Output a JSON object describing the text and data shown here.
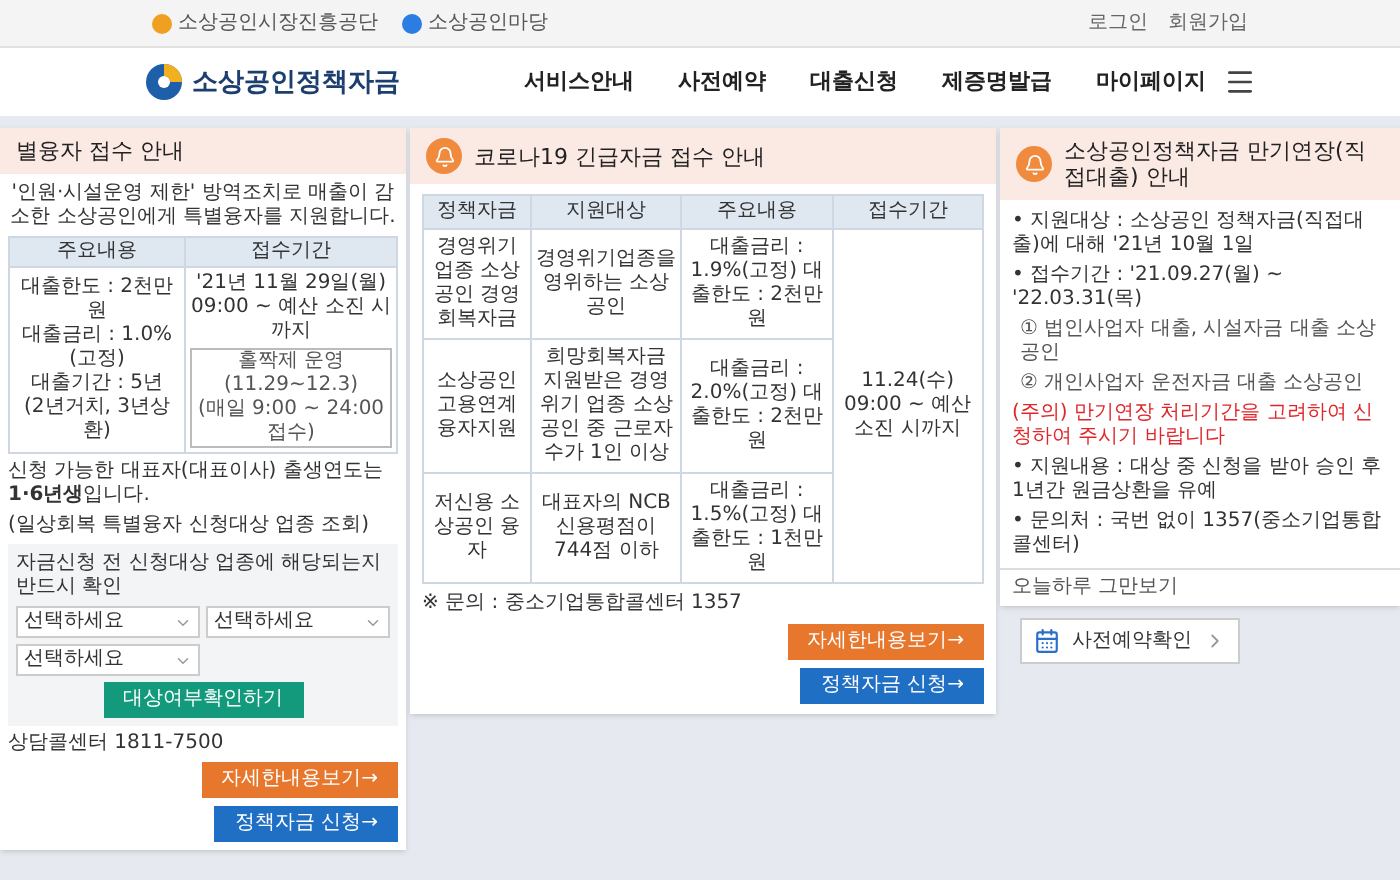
{
  "top_bar": {
    "links_left": [
      "소상공인시장진흥공단",
      "소상공인마당"
    ],
    "links_right": [
      "로그인",
      "회원가입"
    ]
  },
  "header": {
    "logo": "소상공인정책자금",
    "nav": [
      "서비스안내",
      "사전예약",
      "대출신청",
      "제증명발급",
      "마이페이지"
    ]
  },
  "popup_left": {
    "title": "별융자 접수 안내",
    "intro": "'인원·시설운영 제한' 방역조치로 매출이 감소한 소상공인에게 특별융자를 지원합니다.",
    "table": {
      "columns": [
        "주요내용",
        "접수기간"
      ],
      "details": [
        "대출한도 : 2천만원",
        "대출금리 : 1.0%(고정)",
        "대출기간 : 5년",
        "(2년거치, 3년상환)"
      ],
      "period": "'21년 11월 29일(월) 09:00 ~ 예산 소진 시까지",
      "period_box": [
        "홀짝제 운영 (11.29~12.3)",
        "(매일 9:00 ~ 24:00 접수)"
      ]
    },
    "notice": "신청 가능한 대표자(대표이사) 출생연도는 **1·6년생**입니다.",
    "lookup_title": "(일상회복 특별융자 신청대상 업종 조회)",
    "lookup_note": "자금신청 전 신청대상 업종에 해당되는지 반드시 확인",
    "selects": [
      "선택하세요",
      "선택하세요",
      "선택하세요"
    ],
    "check_button": "대상여부확인하기",
    "contact": "상담콜센터 1811-7500",
    "buttons": [
      {
        "label": "자세한내용보기→",
        "kind": "detail"
      },
      {
        "label": "정책자금 신청→",
        "kind": "apply"
      }
    ]
  },
  "popup_middle": {
    "title": "코로나19 긴급자금 접수 안내",
    "table": {
      "columns": [
        "정책자금",
        "지원대상",
        "주요내용",
        "접수기간"
      ],
      "rows": [
        {
          "fund": "경영위기업종 소상공인 경영회복자금",
          "target": "경영위기업종을 영위하는 소상공인",
          "details": "대출금리 : 1.9%(고정) 대출한도 : 2천만원"
        },
        {
          "fund": "소상공인 고용연계 융자지원",
          "target": "희망회복자금 지원받은 경영위기 업종 소상공인 중 근로자수가 1인 이상",
          "details": "대출금리 : 2.0%(고정) 대출한도 : 2천만원"
        },
        {
          "fund": "저신용 소상공인 융자",
          "target": "대표자의 NCB 신용평점이 744점 이하",
          "details": "대출금리 : 1.5%(고정) 대출한도 : 1천만원"
        }
      ],
      "period": "11.24(수) 09:00 ~ 예산 소진 시까지"
    },
    "inquiry": "※ 문의 : 중소기업통합콜센터 1357",
    "buttons": [
      {
        "label": "자세한내용보기→",
        "kind": "detail"
      },
      {
        "label": "정책자금 신청→",
        "kind": "apply"
      }
    ]
  },
  "popup_right": {
    "title": "소상공인정책자금 만기연장(직접대출) 안내",
    "lines": [
      {
        "text": "• 지원대상 : 소상공인 정책자금(직접대출)에 대해 '21년 10월 1일",
        "kind": "bullet"
      },
      {
        "text": "• 접수기간 : '21.09.27(월) ~ '22.03.31(목)",
        "kind": "bullet"
      },
      {
        "text": "① 법인사업자 대출, 시설자금 대출 소상공인",
        "kind": "sub"
      },
      {
        "text": "② 개인사업자 운전자금 대출 소상공인",
        "kind": "sub"
      },
      {
        "text": "(주의) 만기연장 처리기간을 고려하여 신청하여 주시기 바랍니다",
        "kind": "note"
      },
      {
        "text": "• 지원내용 : 대상 중 신청을 받아 승인 후 1년간 원금상환을 유예",
        "kind": "bullet"
      },
      {
        "text": "• 문의처 : 국번 없이 1357(중소기업통합콜센터)",
        "kind": "bullet"
      }
    ],
    "footer": "오늘하루 그만보기"
  },
  "bottom_button": "사전예약확인"
}
